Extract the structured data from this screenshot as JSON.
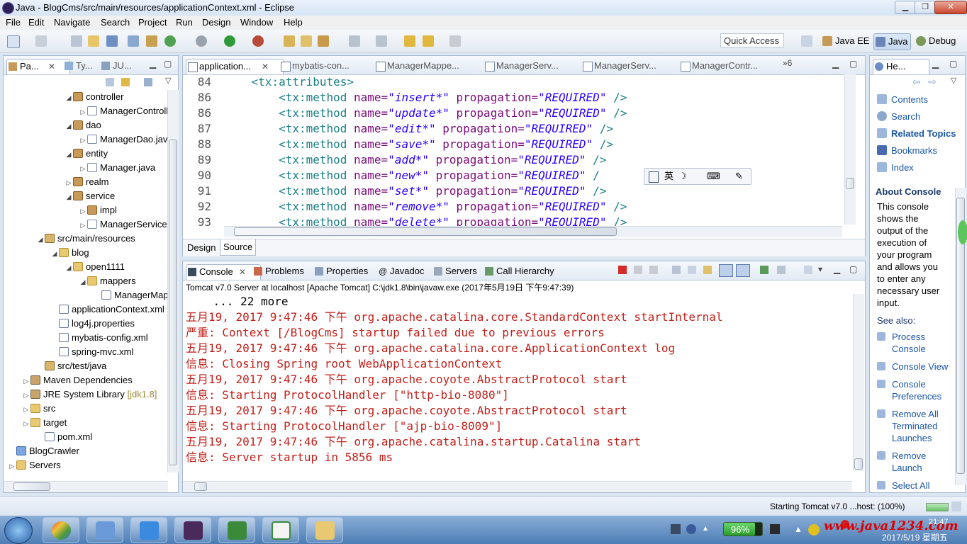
{
  "window": {
    "title": "Java - BlogCms/src/main/resources/applicationContext.xml - Eclipse",
    "minimize_glyph": "▁",
    "maximize_glyph": "❐",
    "close_glyph": "✕"
  },
  "menu": [
    "File",
    "Edit",
    "Navigate",
    "Search",
    "Project",
    "Run",
    "Design",
    "Window",
    "Help"
  ],
  "toolbar": {
    "quick_access": "Quick Access",
    "perspectives": [
      {
        "label": "Java EE",
        "icon": "java-ee-perspective-icon",
        "active": false
      },
      {
        "label": "Java",
        "icon": "java-perspective-icon",
        "active": true
      },
      {
        "label": "Debug",
        "icon": "debug-perspective-icon",
        "active": false
      }
    ]
  },
  "explorer": {
    "tabs": [
      {
        "label": "Pa...",
        "icon": "package-explorer-icon"
      },
      {
        "label": "Ty...",
        "icon": "type-hierarchy-icon"
      },
      {
        "label": "JU...",
        "icon": "junit-icon"
      }
    ],
    "tree": [
      {
        "label": "controller",
        "indent": 4,
        "icon": "pkg",
        "twist": "◢"
      },
      {
        "label": "ManagerController",
        "indent": 5,
        "icon": "java",
        "twist": "▷"
      },
      {
        "label": "dao",
        "indent": 4,
        "icon": "pkg",
        "twist": "◢"
      },
      {
        "label": "ManagerDao.java",
        "indent": 5,
        "icon": "java",
        "twist": "▷"
      },
      {
        "label": "entity",
        "indent": 4,
        "icon": "pkg",
        "twist": "◢"
      },
      {
        "label": "Manager.java",
        "indent": 5,
        "icon": "java",
        "twist": "▷"
      },
      {
        "label": "realm",
        "indent": 4,
        "icon": "pkg",
        "twist": "▷"
      },
      {
        "label": "service",
        "indent": 4,
        "icon": "pkg",
        "twist": "◢"
      },
      {
        "label": "impl",
        "indent": 5,
        "icon": "pkg",
        "twist": "▷"
      },
      {
        "label": "ManagerService.java",
        "indent": 5,
        "icon": "java",
        "twist": "▷"
      },
      {
        "label": "src/main/resources",
        "indent": 2,
        "icon": "src",
        "twist": "◢"
      },
      {
        "label": "blog",
        "indent": 3,
        "icon": "folder",
        "twist": "◢"
      },
      {
        "label": "open1111",
        "indent": 4,
        "icon": "folder",
        "twist": "◢"
      },
      {
        "label": "mappers",
        "indent": 5,
        "icon": "folder",
        "twist": "◢"
      },
      {
        "label": "ManagerMapper.xml",
        "indent": 6,
        "icon": "xml",
        "twist": ""
      },
      {
        "label": "applicationContext.xml",
        "indent": 3,
        "icon": "xml",
        "twist": ""
      },
      {
        "label": "log4j.properties",
        "indent": 3,
        "icon": "xml",
        "twist": ""
      },
      {
        "label": "mybatis-config.xml",
        "indent": 3,
        "icon": "xml",
        "twist": ""
      },
      {
        "label": "spring-mvc.xml",
        "indent": 3,
        "icon": "xml",
        "twist": ""
      },
      {
        "label": "src/test/java",
        "indent": 2,
        "icon": "src",
        "twist": ""
      },
      {
        "label": "Maven Dependencies",
        "indent": 1,
        "icon": "lib",
        "twist": "▷"
      },
      {
        "label": "JRE System Library",
        "indent": 1,
        "icon": "lib",
        "twist": "▷",
        "suffix": "[jdk1.8]"
      },
      {
        "label": "src",
        "indent": 1,
        "icon": "folder",
        "twist": "▷"
      },
      {
        "label": "target",
        "indent": 1,
        "icon": "folder",
        "twist": "▷"
      },
      {
        "label": "pom.xml",
        "indent": 2,
        "icon": "xml",
        "twist": ""
      },
      {
        "label": "BlogCrawler",
        "indent": 0,
        "icon": "proj",
        "twist": ""
      },
      {
        "label": "Servers",
        "indent": 0,
        "icon": "folder",
        "twist": "▷"
      }
    ]
  },
  "editor": {
    "tabs": [
      {
        "label": "application...",
        "active": true
      },
      {
        "label": "mybatis-con...",
        "active": false
      },
      {
        "label": "ManagerMappe...",
        "active": false
      },
      {
        "label": "ManagerServ...",
        "active": false
      },
      {
        "label": "ManagerServ...",
        "active": false
      },
      {
        "label": "ManagerContr...",
        "active": false
      }
    ],
    "overflow_count": "»6",
    "lines": [
      {
        "num": "84",
        "indent": "    ",
        "tag": "<tx:attributes>",
        "attr": "",
        "val": "",
        "attr2": "",
        "val2": "",
        "end": ""
      },
      {
        "num": "86",
        "indent": "        ",
        "tag": "<tx:method",
        "attr": " name=",
        "val": "\"insert*\"",
        "attr2": " propagation=",
        "val2": "\"REQUIRED\"",
        "end": " />"
      },
      {
        "num": "86",
        "indent": "        ",
        "tag": "<tx:method",
        "attr": " name=",
        "val": "\"update*\"",
        "attr2": " propagation=",
        "val2": "\"REQUIRED\"",
        "end": " />"
      },
      {
        "num": "87",
        "indent": "        ",
        "tag": "<tx:method",
        "attr": " name=",
        "val": "\"edit*\"",
        "attr2": " propagation=",
        "val2": "\"REQUIRED\"",
        "end": " />"
      },
      {
        "num": "88",
        "indent": "        ",
        "tag": "<tx:method",
        "attr": " name=",
        "val": "\"save*\"",
        "attr2": " propagation=",
        "val2": "\"REQUIRED\"",
        "end": " />"
      },
      {
        "num": "89",
        "indent": "        ",
        "tag": "<tx:method",
        "attr": " name=",
        "val": "\"add*\"",
        "attr2": " propagation=",
        "val2": "\"REQUIRED\"",
        "end": " />"
      },
      {
        "num": "90",
        "indent": "        ",
        "tag": "<tx:method",
        "attr": " name=",
        "val": "\"new*\"",
        "attr2": " propagation=",
        "val2": "\"REQUIRED\"",
        "end": " /"
      },
      {
        "num": "91",
        "indent": "        ",
        "tag": "<tx:method",
        "attr": " name=",
        "val": "\"set*\"",
        "attr2": " propagation=",
        "val2": "\"REQUIRED\"",
        "end": " />"
      },
      {
        "num": "92",
        "indent": "        ",
        "tag": "<tx:method",
        "attr": " name=",
        "val": "\"remove*\"",
        "attr2": " propagation=",
        "val2": "\"REQUIRED\"",
        "end": " />"
      },
      {
        "num": "93",
        "indent": "        ",
        "tag": "<tx:method",
        "attr": " name=",
        "val": "\"delete*\"",
        "attr2": " propagation=",
        "val2": "\"REQUIRED\"",
        "end": " />"
      }
    ],
    "ime_toolbar": [
      "英",
      "☽",
      "⌨",
      "✎"
    ],
    "bottom_tabs": [
      "Design",
      "Source"
    ],
    "active_bottom_tab": "Source"
  },
  "console": {
    "tabs": [
      "Console",
      "Problems",
      "Properties",
      "Javadoc",
      "Servers",
      "Call Hierarchy"
    ],
    "header": "Tomcat v7.0 Server at localhost [Apache Tomcat] C:\\jdk1.8\\bin\\javaw.exe (2017年5月19日 下午9:47:39)",
    "lines": [
      {
        "text": "    ... 22 more",
        "color": "black"
      },
      {
        "text": "五月19, 2017 9:47:46 下午 org.apache.catalina.core.StandardContext startInternal",
        "color": "red"
      },
      {
        "text": "严重: Context [/BlogCms] startup failed due to previous errors",
        "color": "red"
      },
      {
        "text": "五月19, 2017 9:47:46 下午 org.apache.catalina.core.ApplicationContext log",
        "color": "red"
      },
      {
        "text": "信息: Closing Spring root WebApplicationContext",
        "color": "red"
      },
      {
        "text": "五月19, 2017 9:47:46 下午 org.apache.coyote.AbstractProtocol start",
        "color": "red"
      },
      {
        "text": "信息: Starting ProtocolHandler [\"http-bio-8080\"]",
        "color": "red"
      },
      {
        "text": "五月19, 2017 9:47:46 下午 org.apache.coyote.AbstractProtocol start",
        "color": "red"
      },
      {
        "text": "信息: Starting ProtocolHandler [\"ajp-bio-8009\"]",
        "color": "red"
      },
      {
        "text": "五月19, 2017 9:47:46 下午 org.apache.catalina.startup.Catalina start",
        "color": "red"
      },
      {
        "text": "信息: Server startup in 5856 ms",
        "color": "red"
      }
    ]
  },
  "help": {
    "tab": "He...",
    "links": [
      {
        "label": "Contents",
        "icon": "contents-icon",
        "bold": false
      },
      {
        "label": "Search",
        "icon": "search-icon",
        "bold": false
      },
      {
        "label": "Related Topics",
        "icon": "related-topics-icon",
        "bold": true
      },
      {
        "label": "Bookmarks",
        "icon": "bookmarks-icon",
        "bold": false
      },
      {
        "label": "Index",
        "icon": "index-icon",
        "bold": false
      }
    ],
    "about_title": "About Console",
    "about_text": [
      "This console",
      "shows the",
      "output of the",
      "execution of",
      "your program",
      "and allows you",
      "to enter any",
      "necessary user",
      "input."
    ],
    "see_also": "See also:",
    "see_also_links": [
      [
        "Process",
        "Console"
      ],
      [
        "Console View"
      ],
      [
        "Console",
        "Preferences"
      ],
      [
        "Remove All",
        "Terminated",
        "Launches"
      ],
      [
        "Remove",
        "Launch"
      ],
      [
        "Select All"
      ]
    ]
  },
  "status": {
    "text": "Starting Tomcat v7.0 ...host: (100%)"
  },
  "taskbar": {
    "battery": "96%",
    "watermark": "www.java1234.com",
    "clock_time": "21:47",
    "clock_date": "2017/5/19 星期五"
  },
  "colors": {
    "tag": "#1a7f86",
    "attribute": "#7a0a7a",
    "value": "#2a00ff",
    "console_error": "#c0201a",
    "link": "#1a56a6",
    "watermark": "#e00000"
  }
}
